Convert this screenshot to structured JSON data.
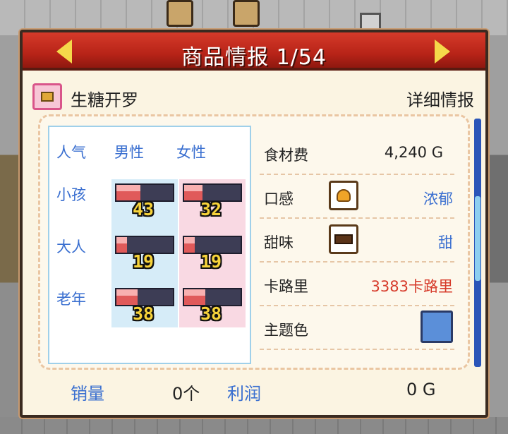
{
  "header": {
    "title": "商品情报 1/54"
  },
  "product": {
    "name": "生糖开罗",
    "detail_label": "详细情报"
  },
  "popularity": {
    "label": "人气",
    "columns": [
      "男性",
      "女性"
    ],
    "rows": [
      {
        "label": "小孩",
        "male": 43,
        "female": 32
      },
      {
        "label": "大人",
        "male": 19,
        "female": 19
      },
      {
        "label": "老年",
        "male": 38,
        "female": 38
      }
    ]
  },
  "info": {
    "ingredient_cost": {
      "label": "食材费",
      "value": "4,240 G"
    },
    "texture": {
      "label": "口感",
      "value": "浓郁",
      "icon": "bread-icon"
    },
    "sweetness": {
      "label": "甜味",
      "value": "甜",
      "icon": "chocolate-icon"
    },
    "calories": {
      "label": "卡路里",
      "value": "3383卡路里"
    },
    "theme_color": {
      "label": "主题色",
      "color": "#5b8fd9"
    }
  },
  "footer": {
    "sales_label": "销量",
    "sales_value": "0个",
    "profit_label": "利润",
    "profit_value": "0 G"
  },
  "colors": {
    "header_red": "#c22c1e",
    "accent_blue": "#3a6fd0",
    "calorie_red": "#d63a2a",
    "gauge_number": "#f7d33a"
  }
}
